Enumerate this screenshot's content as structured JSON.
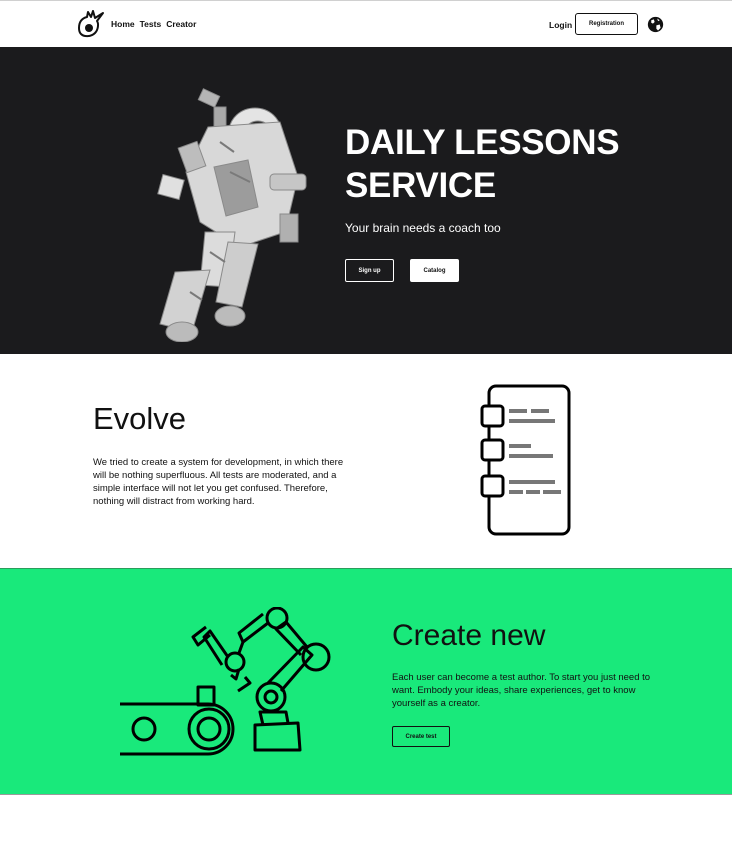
{
  "header": {
    "nav": [
      "Home",
      "Tests",
      "Creator"
    ],
    "login": "Login",
    "registration": "Registration",
    "icons": [
      "meteor-logo-icon",
      "globe-icon"
    ]
  },
  "hero": {
    "title_line1": "DAILY LESSONS",
    "title_line2": "SERVICE",
    "subtitle": "Your brain needs a coach too",
    "signup": "Sign up",
    "catalog": "Catalog"
  },
  "evolve": {
    "title": "Evolve",
    "text": "We tried to create a system for development, in which there will be nothing superfluous. All tests are moderated, and a simple interface will not let you get confused. Therefore, nothing will distract from working hard."
  },
  "create": {
    "title": "Create new",
    "text": "Each user can become a test author. To start you just need to want. Embody your ideas, share experiences, get to know yourself as a creator.",
    "button": "Create test"
  },
  "colors": {
    "hero_bg": "#1b1b1d",
    "accent_green": "#19e97b",
    "text": "#111111"
  }
}
